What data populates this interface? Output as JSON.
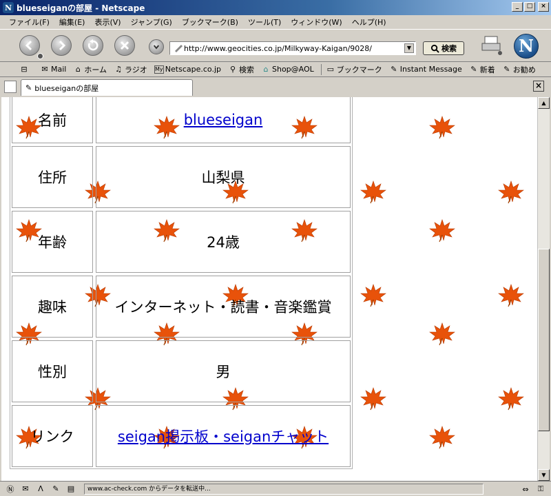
{
  "window": {
    "title": "blueseiganの部屋 - Netscape"
  },
  "menu": [
    "ファイル(F)",
    "編集(E)",
    "表示(V)",
    "ジャンプ(G)",
    "ブックマーク(B)",
    "ツール(T)",
    "ウィンドウ(W)",
    "ヘルプ(H)"
  ],
  "navbar": {
    "url": "http://www.geocities.co.jp/Milkyway-Kaigan/9028/",
    "search_label": "検索"
  },
  "personal_toolbar": {
    "items": [
      "Mail",
      "ホーム",
      "ラジオ",
      "Netscape.co.jp",
      "検索",
      "Shop@AOL",
      "ブックマーク",
      "Instant Message",
      "新着",
      "お勧め"
    ]
  },
  "tab": {
    "label": "blueseiganの部屋"
  },
  "profile": {
    "rows": [
      {
        "label": "名前",
        "value": "blueseigan",
        "link": true
      },
      {
        "label": "住所",
        "value": "山梨県",
        "link": false
      },
      {
        "label": "年齢",
        "value": "24歳",
        "link": false
      },
      {
        "label": "趣味",
        "value": "インターネット・読書・音楽鑑賞",
        "link": false
      },
      {
        "label": "性別",
        "value": "男",
        "link": false
      },
      {
        "label": "リンク",
        "value": "seigan掲示板・seiganチャット",
        "link": true
      }
    ]
  },
  "status": {
    "text": "www.ac-check.com からデータを転送中..."
  },
  "colors": {
    "link": "#0000cc",
    "leaf": "#e8520a",
    "titlebar": "#0a246a"
  }
}
